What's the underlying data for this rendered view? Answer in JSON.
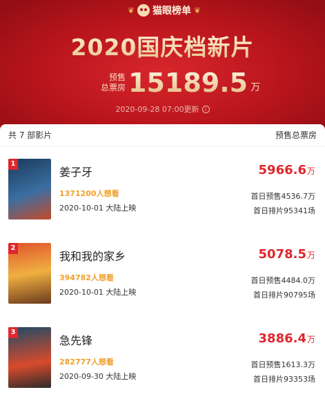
{
  "brand": {
    "name": "猫眼榜单"
  },
  "banner": {
    "title": "2020国庆档新片",
    "presale_label_1": "预售",
    "presale_label_2": "总票房",
    "presale_value": "15189.5",
    "presale_unit": "万",
    "updated": "2020-09-28 07:00更新"
  },
  "list": {
    "count_text": "共 7 部影片",
    "column_label": "预售总票房",
    "movies": [
      {
        "rank": "1",
        "title": "姜子牙",
        "wish": "1371200人想看",
        "release": "2020-10-01 大陆上映",
        "box": "5966.6",
        "box_unit": "万",
        "first_day_presale": "首日预售4536.7万",
        "first_day_screenings": "首日排片95341场",
        "poster_colors": [
          "#1b3a5a",
          "#3a6ea1",
          "#c44b2b"
        ]
      },
      {
        "rank": "2",
        "title": "我和我的家乡",
        "wish": "394782人想看",
        "release": "2020-10-01 大陆上映",
        "box": "5078.5",
        "box_unit": "万",
        "first_day_presale": "首日预售4484.0万",
        "first_day_screenings": "首日排片90795场",
        "poster_colors": [
          "#e0532c",
          "#f0b040",
          "#6b3a1d"
        ]
      },
      {
        "rank": "3",
        "title": "急先锋",
        "wish": "282777人想看",
        "release": "2020-09-30 大陆上映",
        "box": "3886.4",
        "box_unit": "万",
        "first_day_presale": "首日预售1613.3万",
        "first_day_screenings": "首日排片93353场",
        "poster_colors": [
          "#1e4b66",
          "#d84a2c",
          "#2b2b2b"
        ]
      }
    ]
  }
}
